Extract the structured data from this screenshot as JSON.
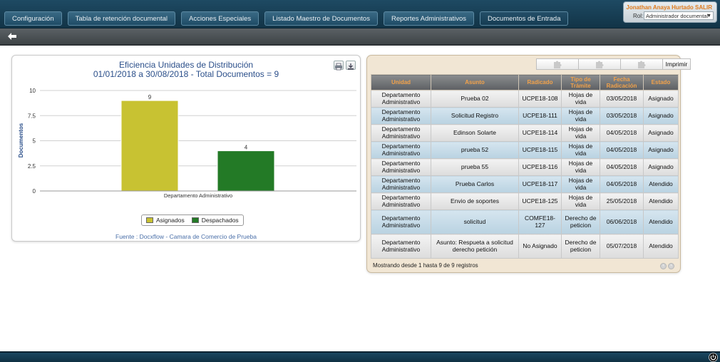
{
  "nav": {
    "items": [
      {
        "label": "Configuración"
      },
      {
        "label": "Tabla de retención documental"
      },
      {
        "label": "Acciones Especiales"
      },
      {
        "label": "Listado Maestro de Documentos"
      },
      {
        "label": "Reportes Administrativos"
      },
      {
        "label": "Documentos de Entrada"
      }
    ],
    "active_index": 5
  },
  "user": {
    "name": "Jonathan Anaya Hurtado",
    "logout_label": "SALIR",
    "role_label": "Rol:",
    "role_value": "Administrador documental"
  },
  "colors": {
    "asignados": "#c8c232",
    "despachados": "#237a26",
    "title": "#2b4f8a",
    "header_text": "#f2a24a"
  },
  "chart": {
    "title_line1": "Eficiencia Unidades de Distribución",
    "title_line2": "01/01/2018 a 30/08/2018 - Total Documentos = 9",
    "source": "Fuente : Docxflow - Camara de Comercio de Prueba",
    "print_icon": "printer-icon",
    "download_icon": "download-icon"
  },
  "chart_data": {
    "type": "bar",
    "title": "Eficiencia Unidades de Distribución",
    "subtitle": "01/01/2018 a 30/08/2018 - Total Documentos = 9",
    "categories": [
      "Departamento Administrativo"
    ],
    "series": [
      {
        "name": "Asignados",
        "values": [
          9
        ]
      },
      {
        "name": "Despachados",
        "values": [
          4
        ]
      }
    ],
    "xlabel": "",
    "ylabel": "Documentos",
    "ylim": [
      0,
      10
    ],
    "yticks": [
      "0",
      "2.5",
      "5",
      "7.5",
      "10"
    ],
    "grid": true,
    "legend": "bottom-center"
  },
  "table": {
    "toolbar": {
      "print_label": "Imprimir"
    },
    "columns": [
      "Unidad",
      "Asunto",
      "Radicado",
      "Tipo de Trámite",
      "Fecha Radicación",
      "Estado"
    ],
    "rows": [
      {
        "unidad": "Departamento Administrativo",
        "asunto": "Prueba 02",
        "radicado": "UCPE18-108",
        "tipo": "Hojas de vida",
        "fecha": "03/05/2018",
        "estado": "Asignado"
      },
      {
        "unidad": "Departamento Administrativo",
        "asunto": "Solicitud Registro",
        "radicado": "UCPE18-111",
        "tipo": "Hojas de vida",
        "fecha": "03/05/2018",
        "estado": "Asignado"
      },
      {
        "unidad": "Departamento Administrativo",
        "asunto": "Edinson Solarte",
        "radicado": "UCPE18-114",
        "tipo": "Hojas de vida",
        "fecha": "04/05/2018",
        "estado": "Asignado"
      },
      {
        "unidad": "Departamento Administrativo",
        "asunto": "prueba 52",
        "radicado": "UCPE18-115",
        "tipo": "Hojas de vida",
        "fecha": "04/05/2018",
        "estado": "Asignado"
      },
      {
        "unidad": "Departamento Administrativo",
        "asunto": "prueba 55",
        "radicado": "UCPE18-116",
        "tipo": "Hojas de vida",
        "fecha": "04/05/2018",
        "estado": "Asignado"
      },
      {
        "unidad": "Departamento Administrativo",
        "asunto": "Prueba Carlos",
        "radicado": "UCPE18-117",
        "tipo": "Hojas de vida",
        "fecha": "04/05/2018",
        "estado": "Atendido"
      },
      {
        "unidad": "Departamento Administrativo",
        "asunto": "Envio de soportes",
        "radicado": "UCPE18-125",
        "tipo": "Hojas de vida",
        "fecha": "25/05/2018",
        "estado": "Atendido"
      },
      {
        "unidad": "Departamento Administrativo",
        "asunto": "solicitud",
        "radicado": "COMFE18-127",
        "tipo": "Derecho de peticion",
        "fecha": "06/06/2018",
        "estado": "Atendido"
      },
      {
        "unidad": "Departamento Administrativo",
        "asunto": "Asunto: Respueta a solicitud derecho petición",
        "radicado": "No Asignado",
        "tipo": "Derecho de peticion",
        "fecha": "05/07/2018",
        "estado": "Atendido"
      }
    ],
    "footer": "Mostrando desde 1 hasta 9 de 9 registros"
  }
}
